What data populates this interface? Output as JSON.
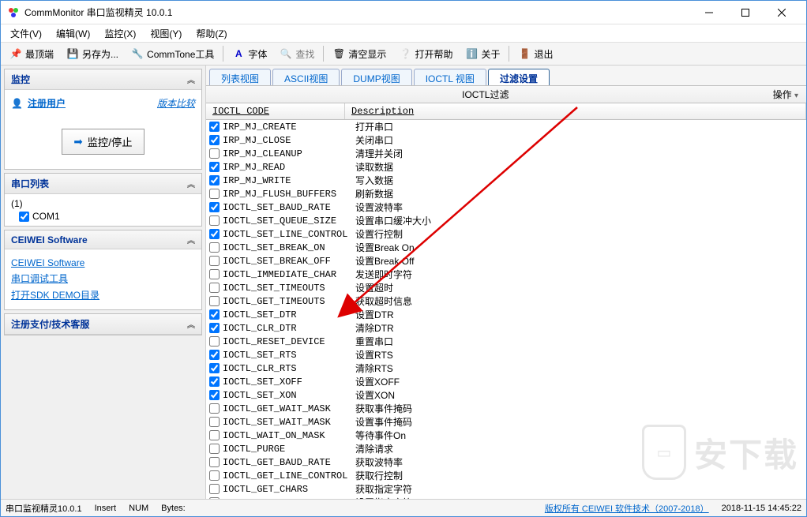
{
  "title": "CommMonitor 串口监视精灵 10.0.1",
  "menus": [
    "文件(V)",
    "编辑(W)",
    "监控(X)",
    "视图(Y)",
    "帮助(Z)"
  ],
  "toolbar": {
    "top": "最顶端",
    "saveas": "另存为...",
    "commtone": "CommTone工具",
    "font": "字体",
    "find": "查找",
    "clear": "清空显示",
    "help": "打开帮助",
    "about": "关于",
    "exit": "退出"
  },
  "sidebar": {
    "monitor_title": "监控",
    "register_user": "注册用户",
    "version_compare": "版本比较",
    "monitor_btn": "监控/停止",
    "ports_title": "串口列表",
    "ports_group": "(1)",
    "ports_item": "COM1",
    "software_title": "CEIWEI Software",
    "software_links": [
      "CEIWEI Software",
      "串口调试工具",
      "打开SDK DEMO目录"
    ],
    "support_title": "注册支付/技术客服"
  },
  "tabs": [
    "列表视图",
    "ASCII视图",
    "DUMP视图",
    "IOCTL 视图",
    "过滤设置"
  ],
  "active_tab": 4,
  "filter": {
    "title": "IOCTL过滤",
    "actions": "操作",
    "col_code": "IOCTL CODE",
    "col_desc": "Description",
    "items": [
      {
        "c": true,
        "code": "IRP_MJ_CREATE",
        "desc": "打开串口"
      },
      {
        "c": true,
        "code": "IRP_MJ_CLOSE",
        "desc": "关闭串口"
      },
      {
        "c": false,
        "code": "IRP_MJ_CLEANUP",
        "desc": "清理并关闭"
      },
      {
        "c": true,
        "code": "IRP_MJ_READ",
        "desc": "读取数据"
      },
      {
        "c": true,
        "code": "IRP_MJ_WRITE",
        "desc": "写入数据"
      },
      {
        "c": false,
        "code": "IRP_MJ_FLUSH_BUFFERS",
        "desc": "刷新数据"
      },
      {
        "c": true,
        "code": "IOCTL_SET_BAUD_RATE",
        "desc": "设置波特率"
      },
      {
        "c": false,
        "code": "IOCTL_SET_QUEUE_SIZE",
        "desc": "设置串口缓冲大小"
      },
      {
        "c": true,
        "code": "IOCTL_SET_LINE_CONTROL",
        "desc": "设置行控制"
      },
      {
        "c": false,
        "code": "IOCTL_SET_BREAK_ON",
        "desc": "设置Break On"
      },
      {
        "c": false,
        "code": "IOCTL_SET_BREAK_OFF",
        "desc": "设置Break Off"
      },
      {
        "c": false,
        "code": "IOCTL_IMMEDIATE_CHAR",
        "desc": "发送即时字符"
      },
      {
        "c": false,
        "code": "IOCTL_SET_TIMEOUTS",
        "desc": "设置超时"
      },
      {
        "c": false,
        "code": "IOCTL_GET_TIMEOUTS",
        "desc": "获取超时信息"
      },
      {
        "c": true,
        "code": "IOCTL_SET_DTR",
        "desc": "设置DTR"
      },
      {
        "c": true,
        "code": "IOCTL_CLR_DTR",
        "desc": "清除DTR"
      },
      {
        "c": false,
        "code": "IOCTL_RESET_DEVICE",
        "desc": "重置串口"
      },
      {
        "c": true,
        "code": "IOCTL_SET_RTS",
        "desc": "设置RTS"
      },
      {
        "c": true,
        "code": "IOCTL_CLR_RTS",
        "desc": "清除RTS"
      },
      {
        "c": true,
        "code": "IOCTL_SET_XOFF",
        "desc": "设置XOFF"
      },
      {
        "c": true,
        "code": "IOCTL_SET_XON",
        "desc": "设置XON"
      },
      {
        "c": false,
        "code": "IOCTL_GET_WAIT_MASK",
        "desc": "获取事件掩码"
      },
      {
        "c": false,
        "code": "IOCTL_SET_WAIT_MASK",
        "desc": "设置事件掩码"
      },
      {
        "c": false,
        "code": "IOCTL_WAIT_ON_MASK",
        "desc": "等待事件On"
      },
      {
        "c": false,
        "code": "IOCTL_PURGE",
        "desc": "清除请求"
      },
      {
        "c": false,
        "code": "IOCTL_GET_BAUD_RATE",
        "desc": "获取波特率"
      },
      {
        "c": false,
        "code": "IOCTL_GET_LINE_CONTROL",
        "desc": "获取行控制"
      },
      {
        "c": false,
        "code": "IOCTL_GET_CHARS",
        "desc": "获取指定字符"
      },
      {
        "c": false,
        "code": "IOCTL_SET_CHARS",
        "desc": "设置指定字符"
      }
    ]
  },
  "statusbar": {
    "app": "串口监视精灵10.0.1",
    "insert": "Insert",
    "num": "NUM",
    "bytes": "Bytes:",
    "copyright": "版权所有 CEIWEI 软件技术（2007-2018）",
    "timestamp": "2018-11-15 14:45:22"
  },
  "watermark": "安下载"
}
